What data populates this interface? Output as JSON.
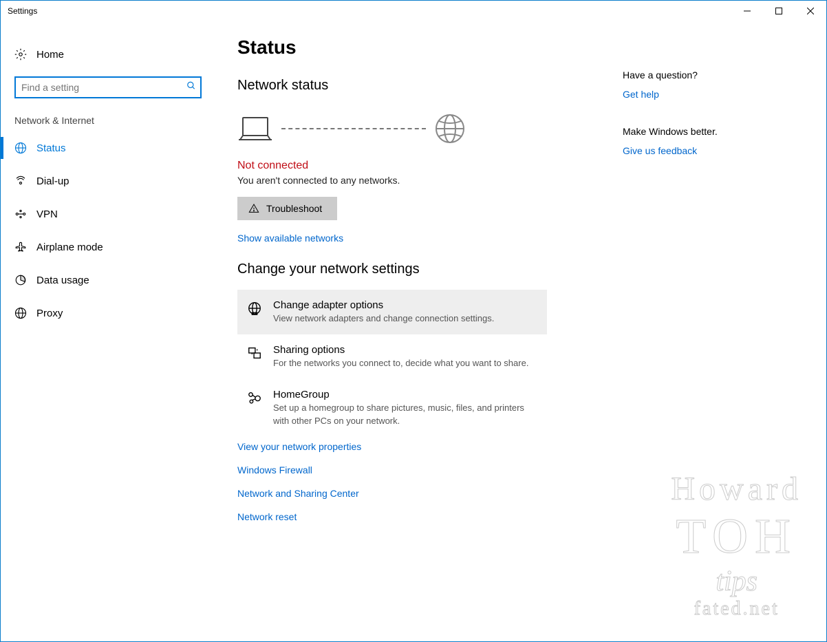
{
  "window": {
    "title": "Settings"
  },
  "sidebar": {
    "home": "Home",
    "search_placeholder": "Find a setting",
    "section": "Network & Internet",
    "items": [
      {
        "label": "Status",
        "active": true
      },
      {
        "label": "Dial-up",
        "active": false
      },
      {
        "label": "VPN",
        "active": false
      },
      {
        "label": "Airplane mode",
        "active": false
      },
      {
        "label": "Data usage",
        "active": false
      },
      {
        "label": "Proxy",
        "active": false
      }
    ]
  },
  "main": {
    "title": "Status",
    "network_status_heading": "Network status",
    "connection_state": "Not connected",
    "connection_desc": "You aren't connected to any networks.",
    "troubleshoot_label": "Troubleshoot",
    "show_networks_link": "Show available networks",
    "change_settings_heading": "Change your network settings",
    "options": [
      {
        "title": "Change adapter options",
        "desc": "View network adapters and change connection settings.",
        "hovered": true
      },
      {
        "title": "Sharing options",
        "desc": "For the networks you connect to, decide what you want to share.",
        "hovered": false
      },
      {
        "title": "HomeGroup",
        "desc": "Set up a homegroup to share pictures, music, files, and printers with other PCs on your network.",
        "hovered": false
      }
    ],
    "extra_links": [
      "View your network properties",
      "Windows Firewall",
      "Network and Sharing Center",
      "Network reset"
    ]
  },
  "rightpane": {
    "question_title": "Have a question?",
    "get_help_link": "Get help",
    "feedback_title": "Make Windows better.",
    "feedback_link": "Give us feedback"
  },
  "watermark": {
    "line1": "Howard",
    "line2": "TOH",
    "line3": "tips",
    "line4": "fated.net"
  }
}
